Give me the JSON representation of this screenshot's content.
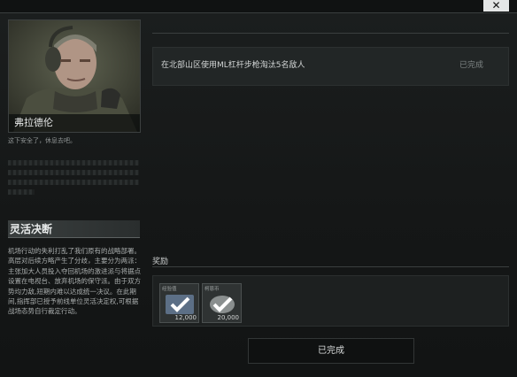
{
  "window": {
    "close_symbol": "✕"
  },
  "trader": {
    "name": "弗拉德伦",
    "greeting": "这下安全了，休息去吧。"
  },
  "quest": {
    "title": "灵活决断",
    "description": "机场行动的失利打乱了我们原有的战略部署。高层对后续方略产生了分歧，主要分为两派：主张加大人员投入夺回机场的激进派与将据点设置在电视台、放弃机场的保守派。由于双方势均力敌,短期内难以达成统一决议。在此期间,指挥部已授予前线单位灵活决定权,可根据战场态势自行裁定行动。"
  },
  "objective": {
    "text": "在北部山区使用ML杠杆步枪淘汰5名敌人",
    "status": "已完成"
  },
  "rewards": {
    "label": "奖励",
    "items": [
      {
        "type": "经验值",
        "amount": "12,000",
        "icon": "xp-checkmark-icon"
      },
      {
        "type": "柯恩币",
        "amount": "20,000",
        "icon": "koen-coin-checkmark-icon"
      }
    ]
  },
  "actions": {
    "complete_label": "已完成"
  },
  "colors": {
    "background": "#121414",
    "panel": "#222626",
    "accent": "#d8dbdb"
  }
}
